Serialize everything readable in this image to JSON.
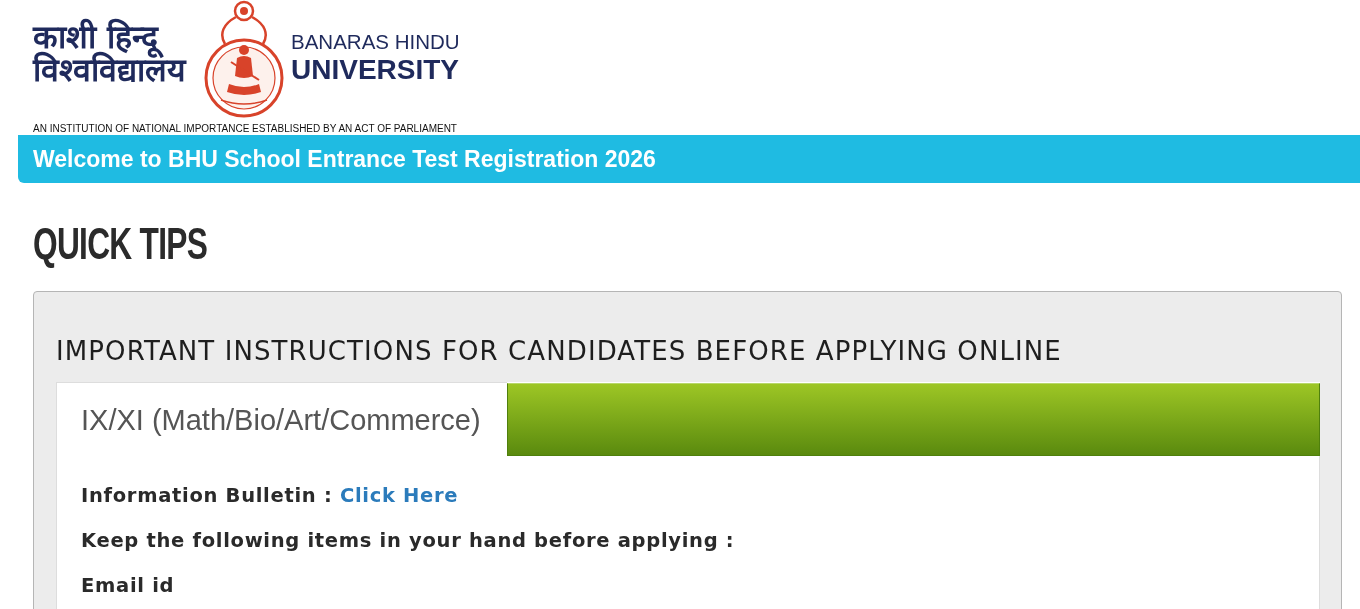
{
  "header": {
    "logo_hindi_line_1": "काशी हिन्दू",
    "logo_hindi_line_2": "विश्वविद्यालय",
    "logo_english_line_1": "BANARAS HINDU",
    "logo_english_line_2": "UNIVERSITY",
    "tagline": "AN INSTITUTION OF NATIONAL IMPORTANCE ESTABLISHED BY AN ACT OF PARLIAMENT"
  },
  "banner": {
    "text": "Welcome to BHU School Entrance Test Registration 2026"
  },
  "page_title": "QUICK TIPS",
  "instructions_panel": {
    "heading": "IMPORTANT INSTRUCTIONS FOR CANDIDATES BEFORE APPLYING ONLINE",
    "tabs": [
      {
        "label": "IX/XI (Math/Bio/Art/Commerce)",
        "selected": true
      }
    ],
    "content": [
      {
        "kind": "link_line",
        "label": "Information Bulletin :",
        "link": "Click Here"
      },
      {
        "kind": "text",
        "text": "Keep the following items in your hand before applying :"
      },
      {
        "kind": "text",
        "text": "Email id"
      }
    ]
  }
}
